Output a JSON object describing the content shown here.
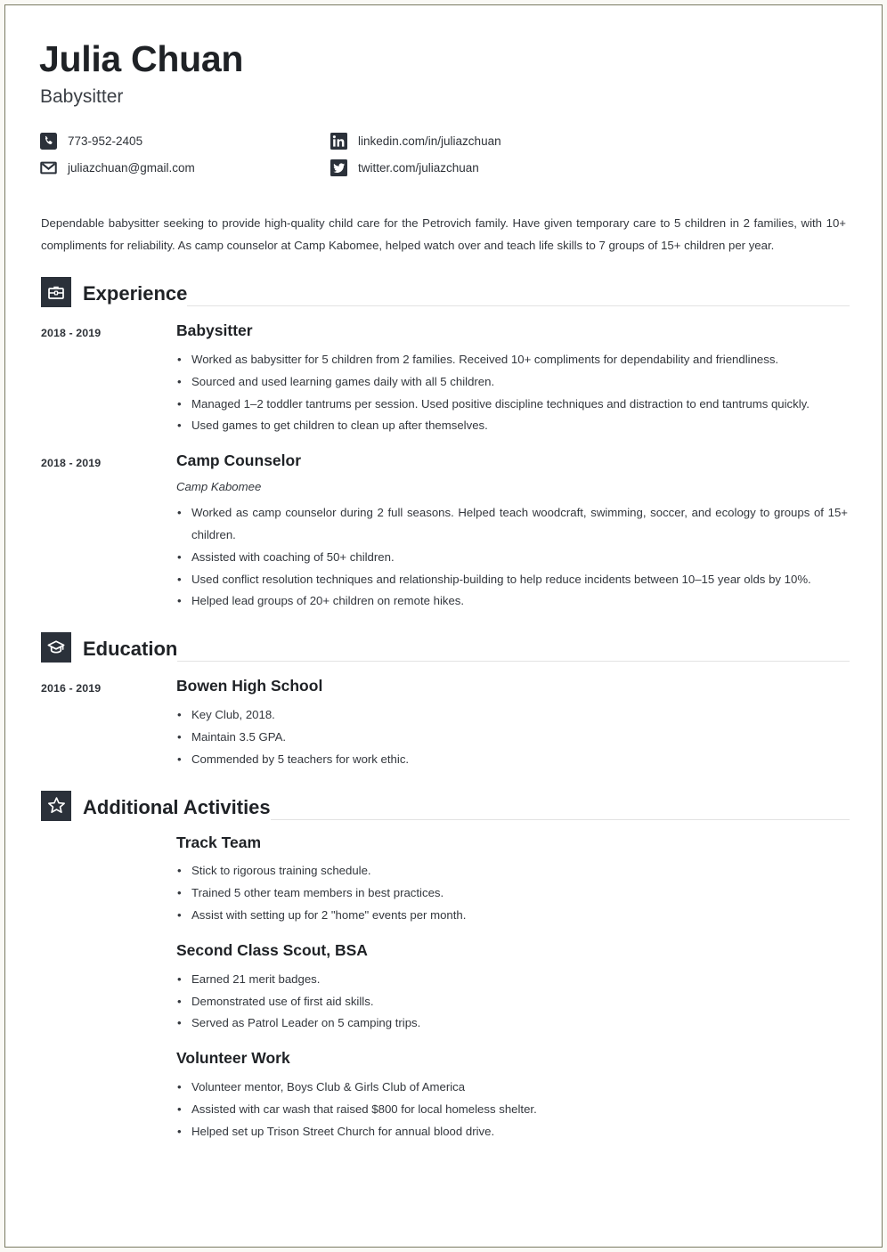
{
  "header": {
    "name": "Julia Chuan",
    "job_title": "Babysitter",
    "contacts": [
      {
        "icon": "phone-icon",
        "text": "773-952-2405"
      },
      {
        "icon": "linkedin-icon",
        "text": "linkedin.com/in/juliazchuan"
      },
      {
        "icon": "email-icon",
        "text": "juliazchuan@gmail.com"
      },
      {
        "icon": "twitter-icon",
        "text": "twitter.com/juliazchuan"
      }
    ]
  },
  "summary": "Dependable babysitter seeking to provide high-quality child care for the Petrovich family. Have given temporary care to 5 children in 2 families, with 10+ compliments for reliability. As camp counselor at Camp Kabomee, helped watch over and teach life skills to 7 groups of 15+ children per year.",
  "sections": {
    "experience": {
      "title": "Experience",
      "icon": "briefcase-icon",
      "entries": [
        {
          "date": "2018 - 2019",
          "title": "Babysitter",
          "subtitle": "",
          "bullets": [
            "Worked as babysitter for 5 children from 2 families. Received 10+ compliments for dependability and friendliness.",
            "Sourced and used learning games daily with all 5 children.",
            "Managed 1–2 toddler tantrums per session. Used positive discipline techniques and distraction to end tantrums quickly.",
            "Used games to get children to clean up after themselves."
          ]
        },
        {
          "date": "2018 - 2019",
          "title": "Camp Counselor",
          "subtitle": "Camp Kabomee",
          "bullets": [
            "Worked as camp counselor during 2 full seasons. Helped teach woodcraft, swimming, soccer, and ecology to groups of 15+ children.",
            "Assisted with coaching of 50+ children.",
            "Used conflict resolution techniques and relationship-building to help reduce incidents between 10–15 year olds by 10%.",
            "Helped lead groups of 20+ children on remote hikes."
          ]
        }
      ]
    },
    "education": {
      "title": "Education",
      "icon": "graduation-cap-icon",
      "entries": [
        {
          "date": "2016 - 2019",
          "title": "Bowen High School",
          "subtitle": "",
          "bullets": [
            "Key Club, 2018.",
            "Maintain 3.5 GPA.",
            "Commended by 5 teachers for work ethic."
          ]
        }
      ]
    },
    "activities": {
      "title": "Additional Activities",
      "icon": "star-icon",
      "entries": [
        {
          "date": "",
          "title": "Track Team",
          "subtitle": "",
          "bullets": [
            "Stick to rigorous training schedule.",
            "Trained 5 other team members in best practices.",
            "Assist with setting up for 2 \"home\" events per month."
          ]
        },
        {
          "date": "",
          "title": "Second Class Scout, BSA",
          "subtitle": "",
          "bullets": [
            "Earned 21 merit badges.",
            "Demonstrated use of first aid skills.",
            "Served as Patrol Leader on 5 camping trips."
          ]
        },
        {
          "date": "",
          "title": "Volunteer Work",
          "subtitle": "",
          "bullets": [
            "Volunteer mentor, Boys Club & Girls Club of America",
            "Assisted with car wash that raised $800 for local homeless shelter.",
            "Helped set up Trison Street Church for annual blood drive."
          ]
        }
      ]
    }
  },
  "colors": {
    "icon_box": "#2b313a",
    "heading": "#1f2226",
    "body_text": "#33373d",
    "rule": "#e2e2e2",
    "page_border": "#7a7a62"
  }
}
